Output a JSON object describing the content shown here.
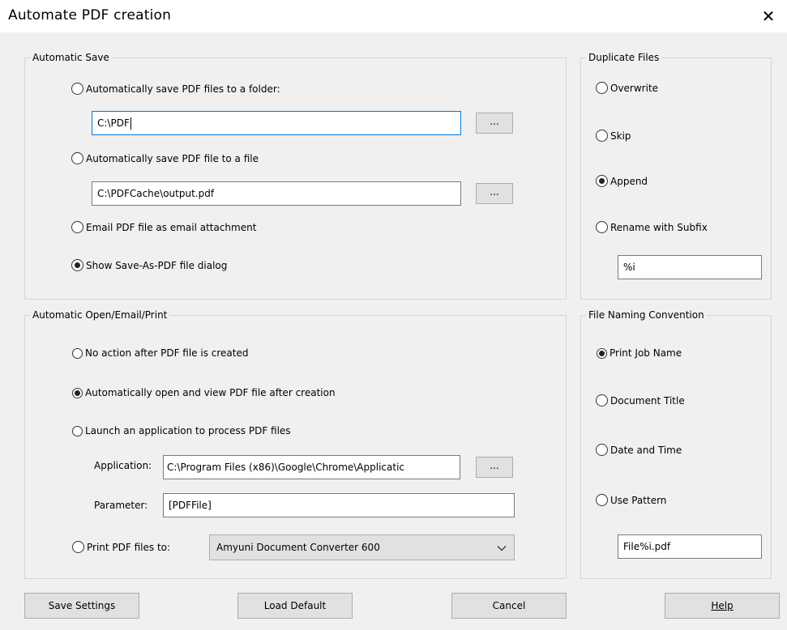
{
  "window": {
    "title": "Automate PDF creation",
    "close_glyph": "✕"
  },
  "automatic_save": {
    "legend": "Automatic Save",
    "options": [
      {
        "label": "Automatically save PDF files to a folder:",
        "selected": false
      },
      {
        "label": "Automatically save PDF file to a file",
        "selected": false
      },
      {
        "label": "Email PDF file as email attachment",
        "selected": false
      },
      {
        "label": "Show Save-As-PDF file dialog",
        "selected": true
      }
    ],
    "folder_path": "C:\\PDF",
    "file_path": "C:\\PDFCache\\output.pdf",
    "browse_label": "..."
  },
  "duplicate_files": {
    "legend": "Duplicate Files",
    "options": [
      {
        "label": "Overwrite",
        "selected": false
      },
      {
        "label": "Skip",
        "selected": false
      },
      {
        "label": "Append",
        "selected": true
      },
      {
        "label": "Rename with Subfix",
        "selected": false
      }
    ],
    "subfix_value": "%i"
  },
  "automatic_open": {
    "legend": "Automatic Open/Email/Print",
    "options": [
      {
        "label": "No action after PDF file is created",
        "selected": false
      },
      {
        "label": "Automatically open and view PDF file after creation",
        "selected": true
      },
      {
        "label": "Launch an application to process PDF files",
        "selected": false
      },
      {
        "label": "Print PDF files to:",
        "selected": false
      }
    ],
    "application_label": "Application:",
    "application_value": "C:\\Program Files (x86)\\Google\\Chrome\\Applicatic",
    "parameter_label": "Parameter:",
    "parameter_value": "[PDFFile]",
    "browse_label": "...",
    "printer_selected": "Amyuni Document Converter 600"
  },
  "file_naming": {
    "legend": "File Naming Convention",
    "options": [
      {
        "label": "Print Job Name",
        "selected": true
      },
      {
        "label": "Document Title",
        "selected": false
      },
      {
        "label": "Date and Time",
        "selected": false
      },
      {
        "label": "Use Pattern",
        "selected": false
      }
    ],
    "pattern_value": "File%i.pdf"
  },
  "buttons": {
    "save_settings": "Save Settings",
    "load_default": "Load Default",
    "cancel": "Cancel",
    "help": "Help"
  }
}
